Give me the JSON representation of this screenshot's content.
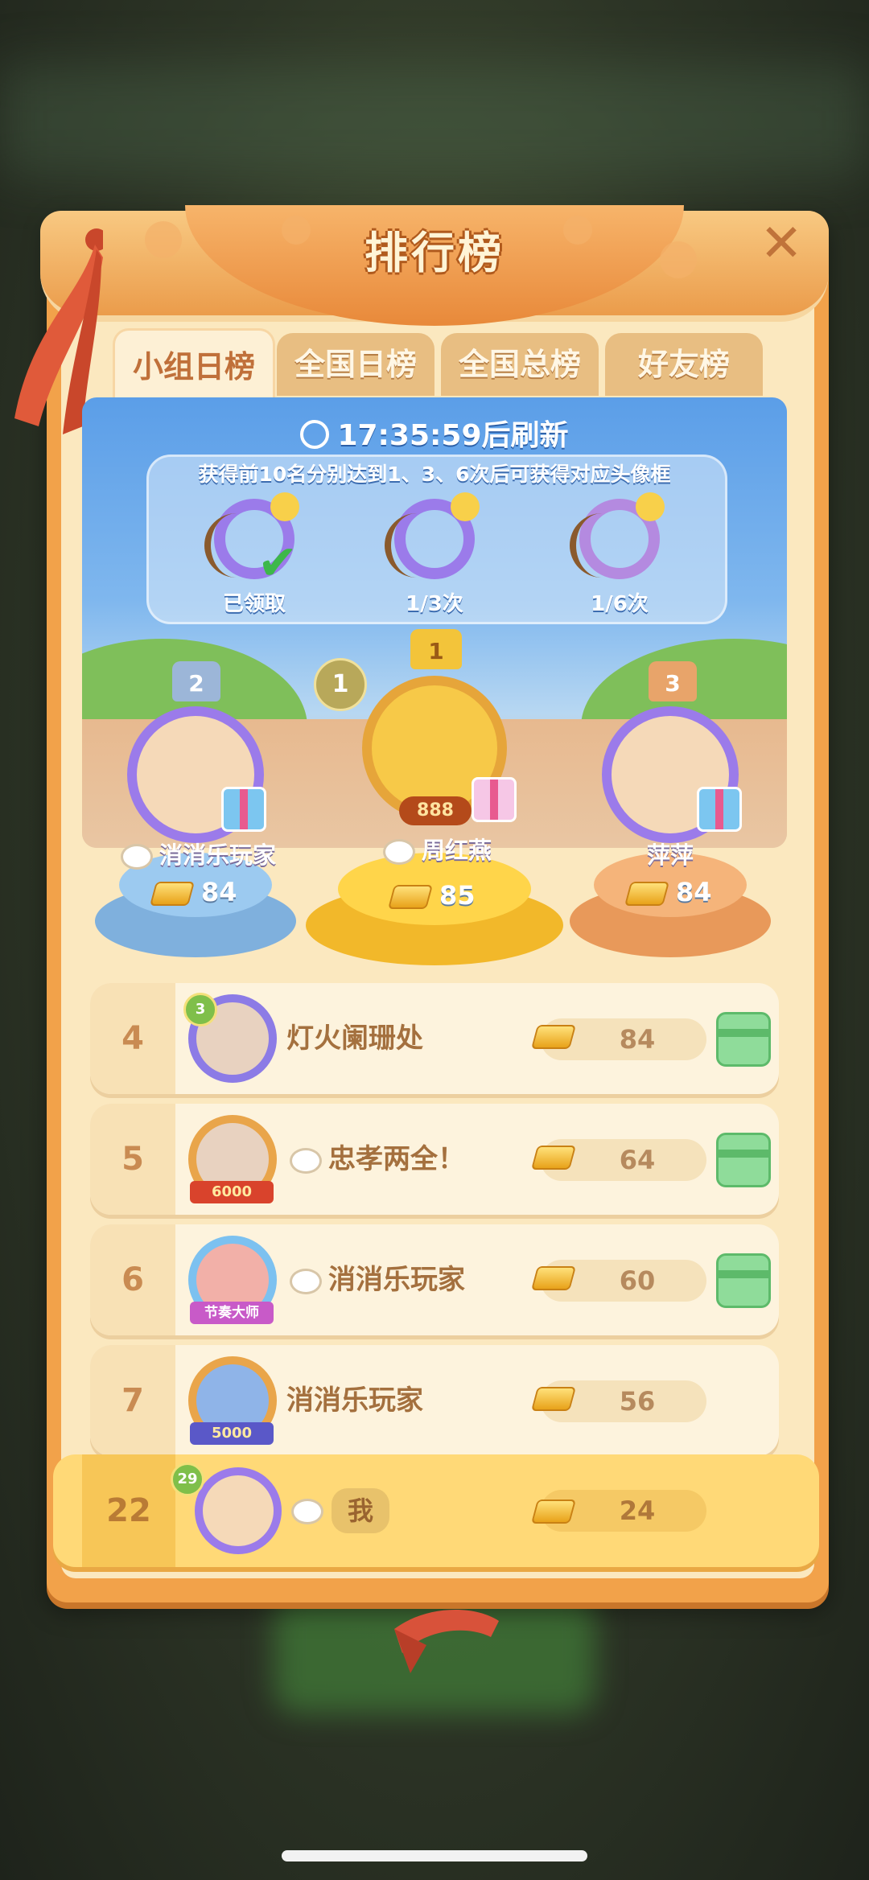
{
  "title": "排行榜",
  "tabs": [
    {
      "label": "小组日榜",
      "active": true
    },
    {
      "label": "全国日榜",
      "active": false
    },
    {
      "label": "全国总榜",
      "active": false
    },
    {
      "label": "好友榜",
      "active": false
    }
  ],
  "refresh": {
    "time": "17:35:59",
    "suffix": "后刷新"
  },
  "frames": {
    "title": "获得前10名分别达到1、3、6次后可获得对应头像框",
    "items": [
      {
        "label": "已领取"
      },
      {
        "label": "1/3次"
      },
      {
        "label": "1/6次"
      }
    ]
  },
  "podium": [
    {
      "rank": "1",
      "name": "周红燕",
      "score": "85",
      "level": "1",
      "badge": "888"
    },
    {
      "rank": "2",
      "name": "消消乐玩家",
      "score": "84"
    },
    {
      "rank": "3",
      "name": "萍萍",
      "score": "84"
    }
  ],
  "rows": [
    {
      "rank": "4",
      "name": "灯火阑珊处",
      "score": "84",
      "level": "3",
      "gift": true
    },
    {
      "rank": "5",
      "name": "忠孝两全！",
      "score": "64",
      "badge": "6000",
      "gift": true
    },
    {
      "rank": "6",
      "name": "消消乐玩家",
      "score": "60",
      "badge": "节奏大师",
      "gift": true
    },
    {
      "rank": "7",
      "name": "消消乐玩家",
      "score": "56",
      "badge": "5000",
      "gift": false
    }
  ],
  "me": {
    "rank": "22",
    "name": "我",
    "score": "24",
    "level": "29"
  },
  "colors": {
    "panel": "#f2a24a",
    "accent": "#c0703a",
    "gift": "#8fdc9a"
  }
}
